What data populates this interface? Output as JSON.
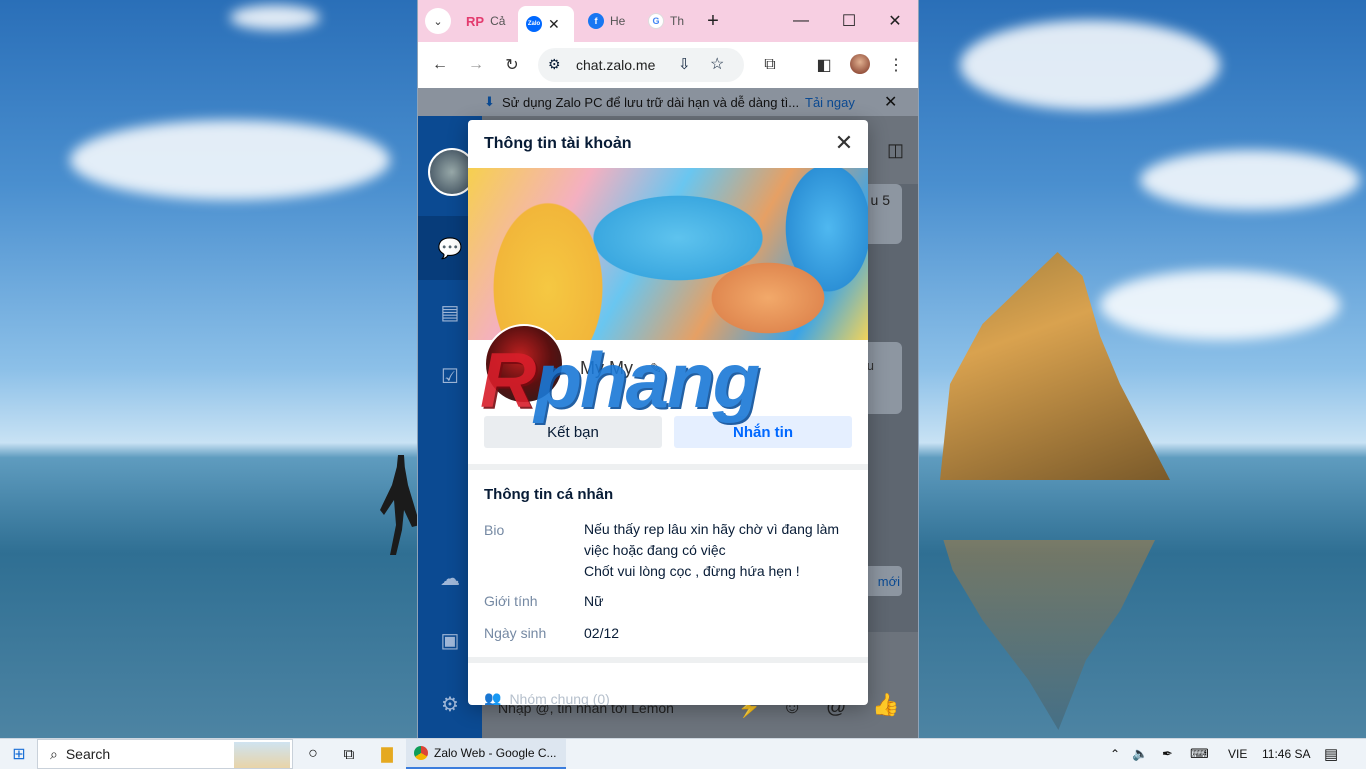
{
  "browser": {
    "tabs": [
      {
        "label": "Cả",
        "favicon": "RP"
      },
      {
        "label": "",
        "favicon": "Zalo",
        "active": true
      },
      {
        "label": "He",
        "favicon": "f"
      },
      {
        "label": "Th",
        "favicon": "G"
      }
    ],
    "new_tab": "+",
    "url": "chat.zalo.me"
  },
  "zalo": {
    "banner_text": "Sử dụng Zalo PC để lưu trữ dài hạn và dễ dàng tì...",
    "banner_link": "Tải ngay",
    "chat_snippet_1": "u 5",
    "chat_snippet_2": "u",
    "new_button": "mới",
    "input_placeholder": "Nhập @, tin nhắn tới Lemon"
  },
  "modal": {
    "title": "Thông tin tài khoản",
    "name": "My My",
    "add_friend": "Kết bạn",
    "message": "Nhắn tin",
    "personal_title": "Thông tin cá nhân",
    "bio_label": "Bio",
    "bio_lines": [
      "Nếu thấy rep lâu xin hãy chờ vì đang làm",
      "việc hoặc đang có việc",
      "Chốt vui lòng cọc , đừng hứa hẹn !"
    ],
    "gender_label": "Giới tính",
    "gender_value": "Nữ",
    "birthday_label": "Ngày sinh",
    "birthday_value": "02/12",
    "groups": "Nhóm chung (0)"
  },
  "watermark": {
    "part1": "R",
    "part2": "phang"
  },
  "taskbar": {
    "search": "Search",
    "chrome_task": "Zalo Web - Google C...",
    "lang": "VIE",
    "time": "11:46 SA"
  }
}
